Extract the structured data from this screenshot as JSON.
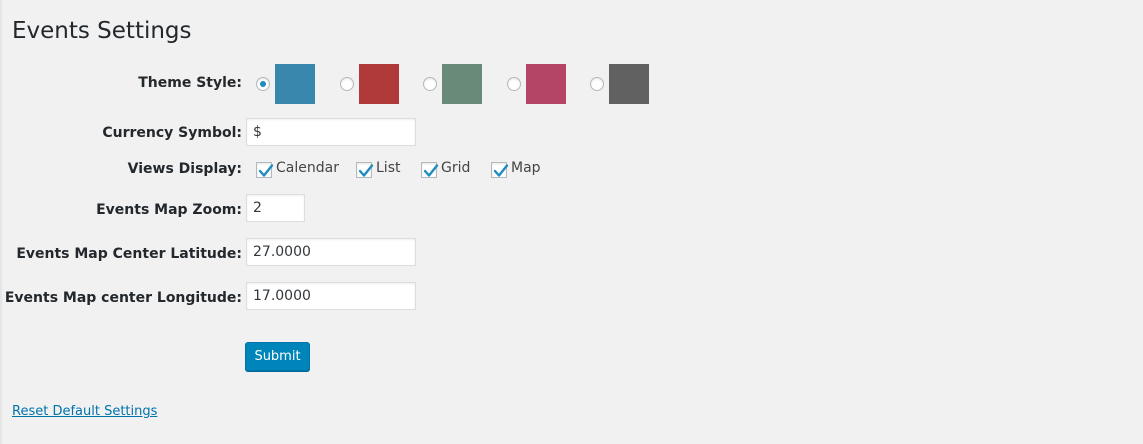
{
  "page": {
    "title": "Events Settings"
  },
  "theme_style": {
    "label": "Theme Style:",
    "selected_index": 0,
    "colors": [
      "#3a87ad",
      "#b03a3a",
      "#6a8a79",
      "#b54567",
      "#616161"
    ]
  },
  "currency": {
    "label": "Currency Symbol:",
    "value": "$"
  },
  "views": {
    "label": "Views Display:",
    "options": [
      {
        "label": "Calendar",
        "checked": true
      },
      {
        "label": "List",
        "checked": true
      },
      {
        "label": "Grid",
        "checked": true
      },
      {
        "label": "Map",
        "checked": true
      }
    ]
  },
  "map_zoom": {
    "label": "Events Map Zoom:",
    "value": "2"
  },
  "latitude": {
    "label": "Events Map Center Latitude:",
    "value": "27.0000"
  },
  "longitude": {
    "label": "Events Map center Longitude:",
    "value": "17.0000"
  },
  "submit": {
    "label": "Submit"
  },
  "reset": {
    "label": "Reset Default Settings"
  },
  "accent_color": "#1e8cbe"
}
